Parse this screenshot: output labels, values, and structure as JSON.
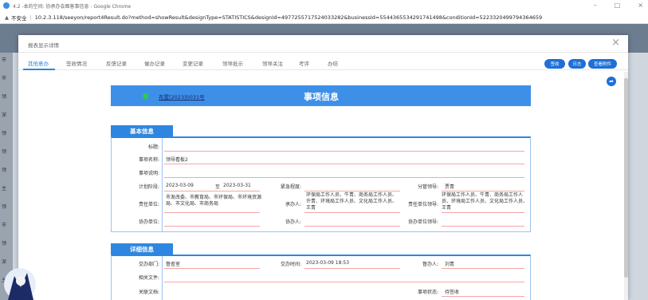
{
  "browser": {
    "window_title": "4.2 -本的空间: 协承办会图客事信息 - Google Chrome",
    "security_label": "不安全",
    "url": "10.2.3.118/seeyon/report4Result.do?method=showResult&designType=STATISTICS&designId=4977255717524033282&businessId=5544365534291741498&conditionId=5223320499794364659"
  },
  "modal": {
    "title": "报表显示详情",
    "close_symbol": "×",
    "tabs": [
      "其他意办",
      "签收情况",
      "反馈记录",
      "催办记录",
      "变更记录",
      "领导批示",
      "领导关注",
      "考评",
      "办结"
    ],
    "actions": [
      "签收",
      "日志",
      "查看附件"
    ]
  },
  "content": {
    "doc_link": "布置[2023]0031号",
    "header_title": "事项信息",
    "basic": {
      "section_title": "基本信息",
      "labels": {
        "title": "标题:",
        "item_name": "事项名称:",
        "item_desc": "事项说明:",
        "plan_stage": "计划阶段:",
        "to": "至",
        "urgency": "紧急程度:",
        "leader": "分管领导:",
        "resp_unit": "责任单位:",
        "undertaker": "承办人:",
        "resp_unit_leader": "责任单位领导:",
        "assist_unit": "协办单位:",
        "assistant": "协办人:",
        "assist_unit_leader": "协办单位领导:"
      },
      "values": {
        "title": "",
        "item_name": "领导看板2",
        "item_desc": "",
        "plan_start": "2023-03-09",
        "plan_end": "2023-03-31",
        "urgency": "",
        "leader": "贾青",
        "resp_unit": "市发改委、市教育局、市环保局、市环境资源局、市文化局、市商务局",
        "undertaker": "环保局工作人员、牛青、商务局工作人员、许青、环境局工作人员、文化局工作人员、王青",
        "resp_unit_leader": "环保局工作人员、牛青、商务局工作人员、环境局工作人员、文化局工作人员、王青",
        "assist_unit": "",
        "assistant": "",
        "assist_unit_leader": ""
      }
    },
    "detail": {
      "section_title": "详细信息",
      "labels": {
        "dept": "交办部门:",
        "time": "交办时间:",
        "supervisor": "督办人:",
        "related_docs": "相关文件:",
        "linked_docs": "关联文档:",
        "status": "事项状态:"
      },
      "values": {
        "dept": "督查室",
        "time": "2023-03-09 18:53",
        "supervisor": "刘青",
        "related_docs": "",
        "linked_docs": "",
        "status": "待签收"
      }
    }
  },
  "background": {
    "sidebar_items": [
      "市",
      "市",
      "领",
      "深",
      "领",
      "领",
      "领",
      "主",
      "领",
      "市",
      "领",
      "深",
      "主"
    ]
  },
  "colors": {
    "accent": "#2f86e0",
    "banner": "#3d8fe8",
    "button": "#1f6fd6",
    "underline": "#f4a6a6"
  }
}
